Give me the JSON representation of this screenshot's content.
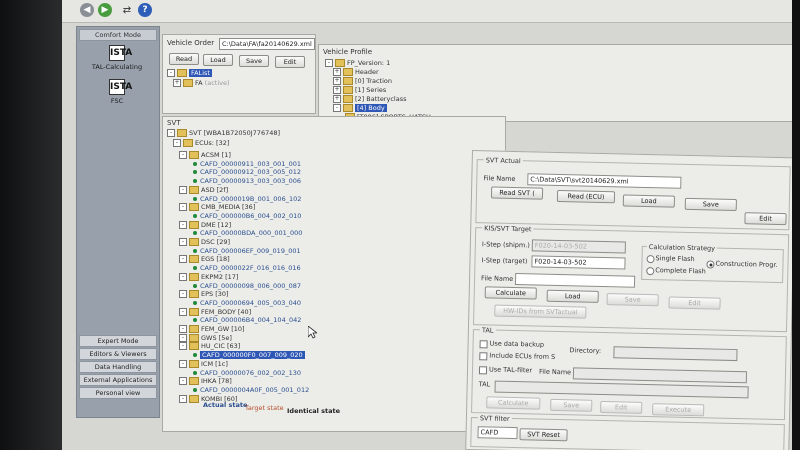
{
  "toolbar": {
    "back_icon": "back-arrow-icon",
    "forward_icon": "forward-arrow-icon",
    "network_icon": "network-icon",
    "help_icon": "help-icon",
    "help_label": "?"
  },
  "leftnav": {
    "header": "Comfort Mode",
    "tools": [
      {
        "label": "TAL-Calculating",
        "icon": "ISTA"
      },
      {
        "label": "FSC",
        "icon": "ISTA"
      }
    ],
    "buttons": [
      "Expert Mode",
      "Editors & Viewers",
      "Data Handling",
      "External Applications",
      "Personal view"
    ]
  },
  "vehicle_order": {
    "title": "Vehicle Order",
    "path": "C:\\Data\\FA\\fa20140629.xml",
    "buttons": [
      "Read",
      "Load",
      "Save",
      "Edit"
    ],
    "tree": [
      {
        "label": "FAList",
        "selected": true
      },
      {
        "label": "FA",
        "extra": "(active)"
      }
    ]
  },
  "vehicle_profile": {
    "title": "Vehicle Profile",
    "tree": [
      "FP_Version: 1",
      "Header",
      "[0] Traction",
      "[1] Series",
      "[2] Batteryclass",
      "[4] Body",
      "[T086] SPORTS_HATCH"
    ]
  },
  "svt": {
    "title": "SVT",
    "root": "SVT [WBA1B72050J776748]",
    "ecus": "ECUs: [32]",
    "rows": [
      {
        "t": "ACSM [1]",
        "k": "ecu"
      },
      {
        "t": "CAFD_00000911_003_001_001",
        "k": "cafd"
      },
      {
        "t": "CAFD_00000912_003_005_012",
        "k": "cafd"
      },
      {
        "t": "CAFD_00000913_003_003_006",
        "k": "cafd"
      },
      {
        "t": "ASD [2f]",
        "k": "ecu"
      },
      {
        "t": "CAFD_0000019B_001_006_102",
        "k": "cafd"
      },
      {
        "t": "CMB_MEDIA [36]",
        "k": "ecu"
      },
      {
        "t": "CAFD_000000B6_004_002_010",
        "k": "cafd"
      },
      {
        "t": "DME [12]",
        "k": "ecu"
      },
      {
        "t": "CAFD_00000BDA_000_001_000",
        "k": "cafd"
      },
      {
        "t": "DSC [29]",
        "k": "ecu"
      },
      {
        "t": "CAFD_000006EF_009_019_001",
        "k": "cafd"
      },
      {
        "t": "EGS [18]",
        "k": "ecu"
      },
      {
        "t": "CAFD_0000022F_016_016_016",
        "k": "cafd"
      },
      {
        "t": "EKPM2 [17]",
        "k": "ecu"
      },
      {
        "t": "CAFD_00000098_006_000_087",
        "k": "cafd"
      },
      {
        "t": "EPS [30]",
        "k": "ecu"
      },
      {
        "t": "CAFD_00000694_005_003_040",
        "k": "cafd"
      },
      {
        "t": "FEM_BODY [40]",
        "k": "ecu"
      },
      {
        "t": "CAFD_000006B4_004_104_042",
        "k": "cafd"
      },
      {
        "t": "FEM_GW [10]",
        "k": "ecu"
      },
      {
        "t": "GWS [5e]",
        "k": "ecu"
      },
      {
        "t": "HU_CIC [63]",
        "k": "ecu"
      },
      {
        "t": "CAFD_000000F0_007_009_020",
        "k": "sel"
      },
      {
        "t": "ICM [1c]",
        "k": "ecu"
      },
      {
        "t": "CAFD_00000076_002_002_130",
        "k": "cafd"
      },
      {
        "t": "IHKA [78]",
        "k": "ecu"
      },
      {
        "t": "CAFD_0000004A0F_005_001_012",
        "k": "cafd"
      },
      {
        "t": "KOMBI [60]",
        "k": "ecu"
      }
    ],
    "legend": {
      "actual": "Actual state",
      "target": "Target state",
      "identical": "Identical state"
    }
  },
  "svt_actual": {
    "title": "SVT Actual",
    "file_label": "File Name",
    "file_value": "C:\\Data\\SVT\\svt20140629.xml",
    "buttons": [
      "Read SVT (",
      "Read (ECU)",
      "Load",
      "Save",
      "Edit"
    ]
  },
  "kis": {
    "title": "KIS/SVT Target",
    "istep_shipm_label": "I-Step (shipm.)",
    "istep_shipm_value": "F020-14-03-502",
    "istep_target_label": "I-Step (target)",
    "istep_target_value": "F020-14-03-502",
    "file_label": "File Name",
    "buttons": [
      "Calculate",
      "Load",
      "Save",
      "Edit"
    ],
    "hw_btn": "HW-IDs from SVTactual",
    "calc_title": "Calculation Strategy",
    "radios": [
      "Single Flash",
      "Complete Flash",
      "Construction Progr."
    ]
  },
  "tal": {
    "title": "TAL",
    "use_backup": "Use data backup",
    "directory": "Directory:",
    "include": "Include ECUs from S",
    "use_filter": "Use TAL-filter",
    "file_name": "File Name",
    "tal_label": "TAL",
    "buttons": [
      "Calculate",
      "Save",
      "Edit",
      "Execute"
    ]
  },
  "svt_filter": {
    "title": "SVT filter",
    "select": "CAFD",
    "button": "SVT Reset"
  },
  "colors": {
    "accent": "#2f57b5",
    "nav_bg": "#98a1ab",
    "cafd_dot": "#1f8a3a",
    "folder": "#e2c05a"
  }
}
